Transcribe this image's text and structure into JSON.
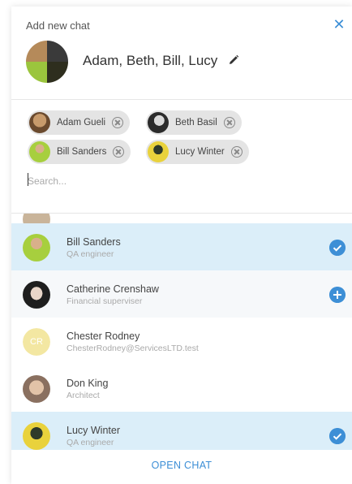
{
  "header": {
    "title": "Add new chat",
    "close_icon": "close-icon",
    "group_name": "Adam, Beth, Bill, Lucy",
    "edit_icon": "pencil-icon"
  },
  "selected_chips": [
    {
      "label": "Adam Gueli"
    },
    {
      "label": "Beth Basil"
    },
    {
      "label": "Bill Sanders"
    },
    {
      "label": "Lucy Winter"
    }
  ],
  "search": {
    "placeholder": "Search..."
  },
  "contacts": [
    {
      "name": "Bill Sanders",
      "subtitle": "QA engineer",
      "selected": true,
      "action_icon": "check-icon"
    },
    {
      "name": "Catherine Crenshaw",
      "subtitle": "Financial superviser",
      "selected": false,
      "action_icon": "plus-icon"
    },
    {
      "name": "Chester Rodney",
      "subtitle": "ChesterRodney@ServicesLTD.test",
      "initials": "CR",
      "selected": false
    },
    {
      "name": "Don King",
      "subtitle": "Architect",
      "selected": false
    },
    {
      "name": "Lucy Winter",
      "subtitle": "QA engineer",
      "selected": true,
      "action_icon": "check-icon"
    }
  ],
  "footer": {
    "open_chat_label": "OPEN CHAT"
  },
  "colors": {
    "accent": "#3d8fd6",
    "selected_row": "#dbeef9",
    "chip_bg": "#e4e4e4"
  }
}
